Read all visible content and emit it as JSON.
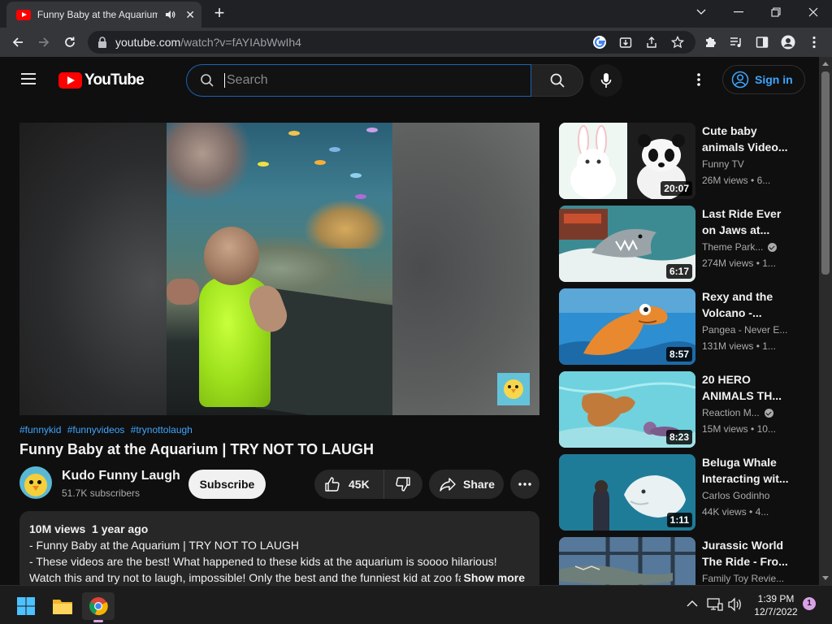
{
  "browser": {
    "tab_title": "Funny Baby at the Aquarium | TRY NOT TO LAUGH",
    "url_host": "youtube.com",
    "url_path": "/watch?v=fAYIAbWwIh4"
  },
  "youtube": {
    "logo_text": "YouTube",
    "search_placeholder": "Search",
    "signin_label": "Sign in"
  },
  "video": {
    "hashtags": [
      "#funnykid",
      "#funnyvideos",
      "#trynottolaugh"
    ],
    "title": "Funny Baby at the Aquarium | TRY NOT TO LAUGH",
    "channel": "Kudo Funny Laugh",
    "subscribers": "51.7K subscribers",
    "subscribe_label": "Subscribe",
    "likes": "45K",
    "share_label": "Share",
    "description": {
      "views": "10M views",
      "age": "1 year ago",
      "line1": "- Funny Baby at the Aquarium | TRY NOT TO LAUGH",
      "line2": "- These videos are the best! What happened to these kids at the aquarium is soooo hilarious! Watch this and try not to laugh, impossible! Only the best and the funniest kid at zoo fail video",
      "show_more": "Show more"
    }
  },
  "recommendations": [
    {
      "title": "Cute baby animals Video...",
      "channel": "Funny TV",
      "verified": false,
      "views": "26M views",
      "age": "• 6...",
      "duration": "20:07"
    },
    {
      "title": "Last Ride Ever on Jaws at...",
      "channel": "Theme Park...",
      "verified": true,
      "views": "274M views",
      "age": "• 1...",
      "duration": "6:17"
    },
    {
      "title": "Rexy and the Volcano -...",
      "channel": "Pangea - Never E...",
      "verified": false,
      "views": "131M views",
      "age": "• 1...",
      "duration": "8:57"
    },
    {
      "title": "20 HERO ANIMALS TH...",
      "channel": "Reaction M...",
      "verified": true,
      "views": "15M views",
      "age": "• 10...",
      "duration": "8:23"
    },
    {
      "title": "Beluga Whale Interacting wit...",
      "channel": "Carlos Godinho",
      "verified": false,
      "views": "44K views",
      "age": "• 4...",
      "duration": "1:11"
    },
    {
      "title": "Jurassic World The Ride - Fro...",
      "channel": "Family Toy Revie...",
      "verified": false,
      "views": "",
      "age": "",
      "duration": ""
    }
  ],
  "taskbar": {
    "time": "1:39 PM",
    "date": "12/7/2022",
    "notification_count": "1"
  }
}
